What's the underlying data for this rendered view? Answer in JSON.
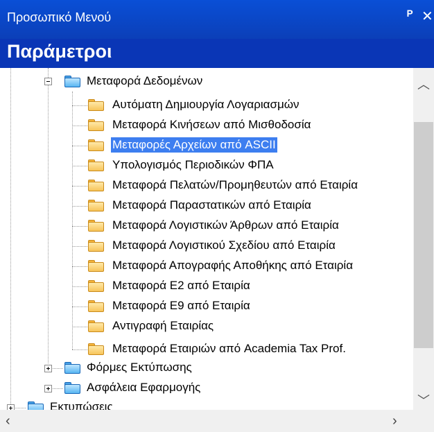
{
  "titlebar": {
    "title": "Προσωπικό Μενού",
    "pin_icon": "pin-icon",
    "close_icon": "close-icon"
  },
  "panel_header": {
    "title": "Παράμετροι"
  },
  "tree": {
    "root_item": {
      "label": "Μεταφορά Δεδομένων",
      "expanded": true
    },
    "children": [
      {
        "label": "Αυτόματη Δημιουργία Λογαριασμών"
      },
      {
        "label": "Μεταφορά Κινήσεων από Μισθοδοσία"
      },
      {
        "label": "Μεταφορές Αρχείων από ASCII",
        "selected": true
      },
      {
        "label": "Υπολογισμός Περιοδικών ΦΠΑ"
      },
      {
        "label": "Μεταφορά Πελατών/Προμηθευτών από Εταιρία"
      },
      {
        "label": "Μεταφορά Παραστατικών από Εταιρία"
      },
      {
        "label": "Μεταφορά Λογιστικών Άρθρων από Εταιρία"
      },
      {
        "label": "Μεταφορά Λογιστικού Σχεδίου από Εταιρία"
      },
      {
        "label": "Μεταφορά Απογραφής Αποθήκης από Εταιρία"
      },
      {
        "label": "Μεταφορά Ε2 από Εταιρία"
      },
      {
        "label": "Μεταφορά Ε9 από Εταιρία"
      },
      {
        "label": "Αντιγραφή Εταιρίας"
      },
      {
        "label": "Μεταφορά Εταιριών από Academia Tax Prof."
      }
    ],
    "siblings": [
      {
        "label": "Φόρμες Εκτύπωσης",
        "expanded": false
      },
      {
        "label": "Ασφάλεια Εφαρμογής",
        "expanded": false
      }
    ],
    "top_level": [
      {
        "label": "Εκτυπώσεις",
        "expanded": false
      }
    ]
  },
  "colors": {
    "title_blue": "#0a4fd6",
    "header_blue": "#0a36b6",
    "selection": "#3d7ef0"
  },
  "scrollbars": {
    "up_icon": "chevron-up-icon",
    "down_icon": "chevron-down-icon",
    "left_icon": "chevron-left-icon",
    "right_icon": "chevron-right-icon"
  }
}
